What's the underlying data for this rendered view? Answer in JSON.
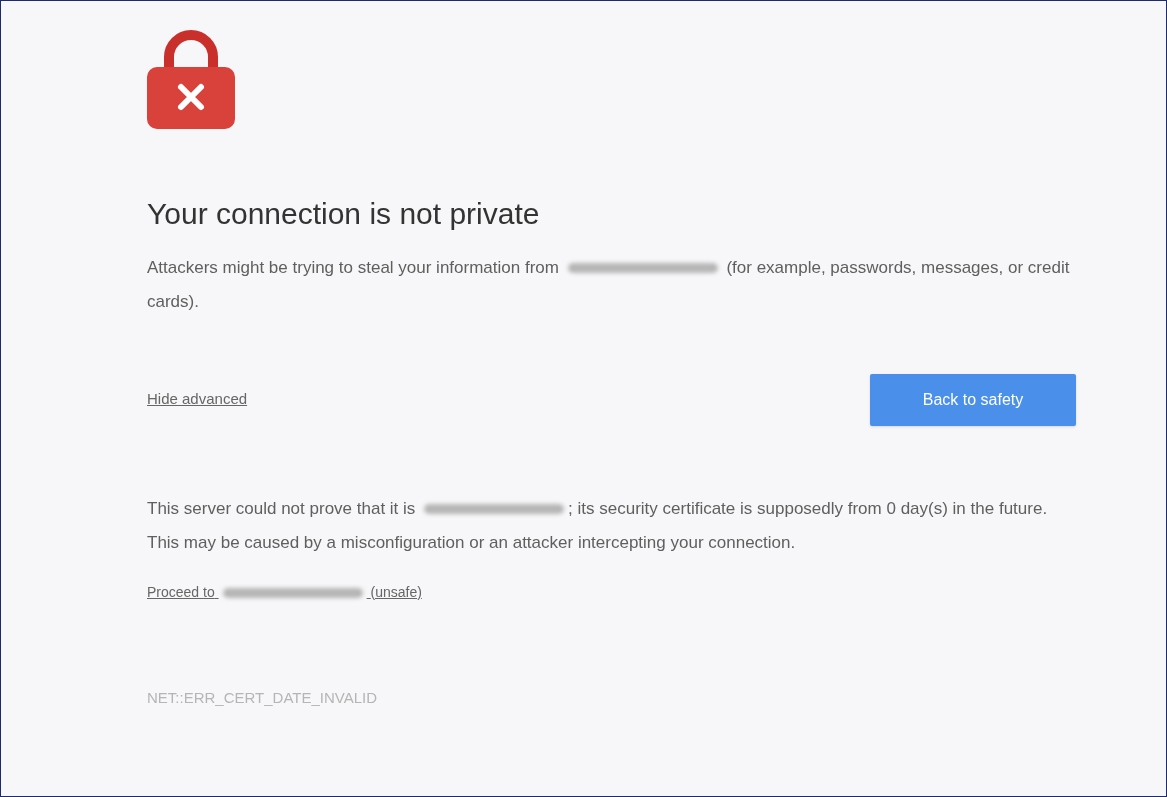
{
  "heading": "Your connection is not private",
  "intro": {
    "text_before": "Attackers might be trying to steal your information from",
    "text_after": "(for example, passwords, messages, or credit cards)."
  },
  "advanced_link": "Hide advanced",
  "primary_button": "Back to safety",
  "details": {
    "text_before": "This server could not prove that it is",
    "text_after": "; its security certificate is supposedly from 0 day(s) in the future. This may be caused by a misconfiguration or an attacker intercepting your connection."
  },
  "proceed_link": {
    "text_before": "Proceed to",
    "text_after": "(unsafe)"
  },
  "error_code": "NET::ERR_CERT_DATE_INVALID"
}
